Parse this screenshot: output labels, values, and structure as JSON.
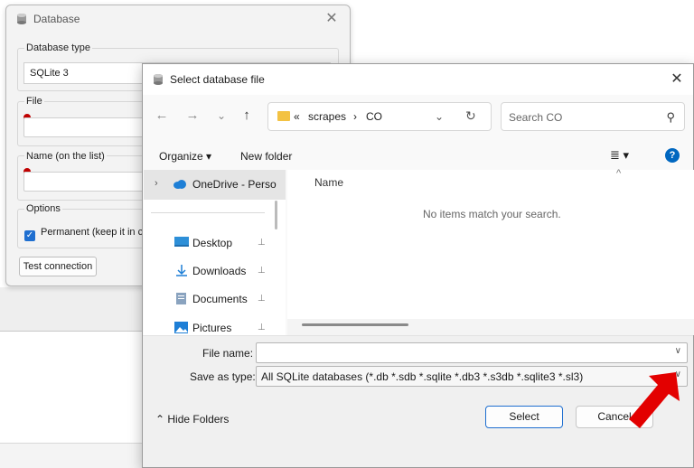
{
  "database_dialog": {
    "title": "Database",
    "close_glyph": "✕",
    "db_type_label": "Database type",
    "db_type_value": "SQLite 3",
    "file_label": "File",
    "name_label": "Name (on the list)",
    "options_label": "Options",
    "permanent_label": "Permanent (keep it in c",
    "test_button": "Test connection"
  },
  "file_dialog": {
    "title": "Select database file",
    "close_glyph": "✕",
    "nav": {
      "back": "←",
      "forward": "→",
      "recent": "⌄",
      "up": "↑"
    },
    "address": {
      "overflow": "«",
      "crumb1": "scrapes",
      "sep": "›",
      "crumb2": "CO",
      "dropdown": "⌄",
      "refresh": "↻"
    },
    "search_placeholder": "Search CO",
    "toolbar": {
      "organize": "Organize ▾",
      "new_folder": "New folder",
      "view": "≣ ▾",
      "help": "?"
    },
    "nav_pane": {
      "onedrive": "OneDrive - Perso",
      "items": [
        {
          "label": "Desktop"
        },
        {
          "label": "Downloads"
        },
        {
          "label": "Documents"
        },
        {
          "label": "Pictures"
        }
      ],
      "pin_glyph": "📌"
    },
    "content": {
      "column_name": "Name",
      "sort_glyph": "^",
      "empty_message": "No items match your search."
    },
    "file_name_label": "File name:",
    "file_name_value": "",
    "save_as_type_label": "Save as type:",
    "save_as_type_value": "All SQLite databases (*.db *.sdb *.sqlite *.db3 *.s3db *.sqlite3 *.sl3)",
    "hide_folders": "Hide Folders",
    "select_button": "Select",
    "cancel_button": "Cancel"
  },
  "colors": {
    "accent": "#0067c0",
    "annotation_arrow": "#e30000"
  }
}
